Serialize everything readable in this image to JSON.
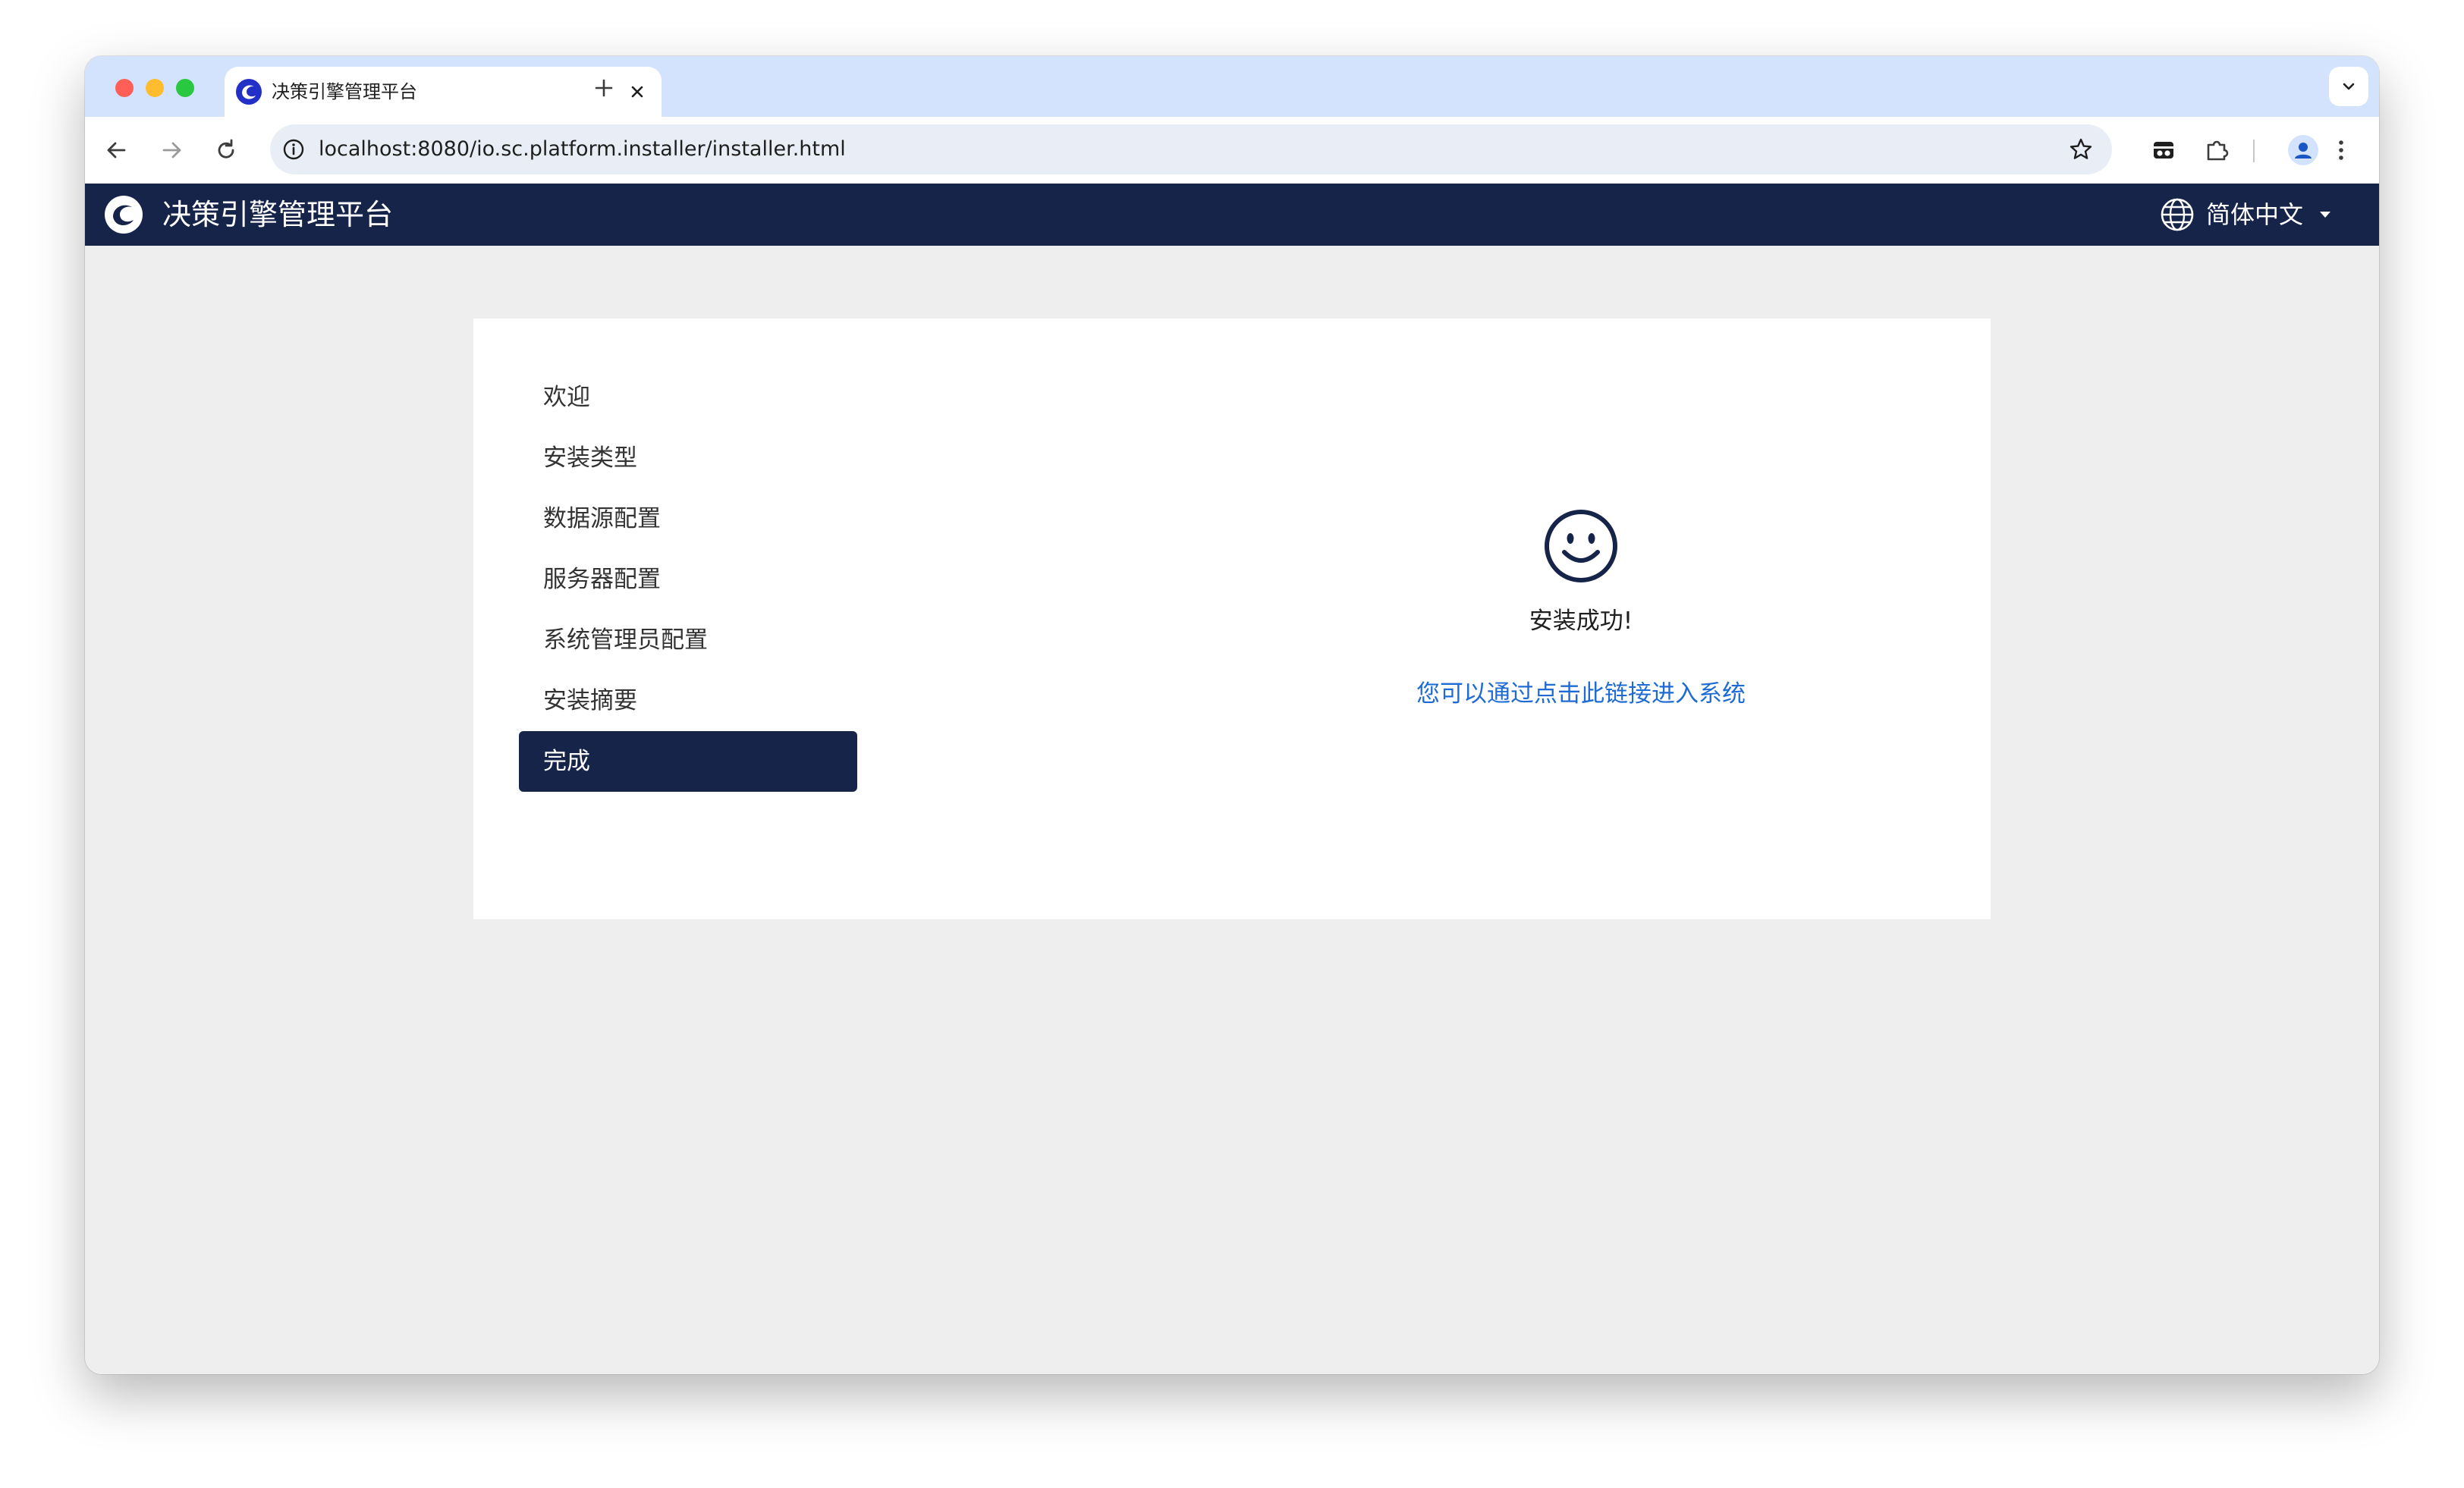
{
  "browser": {
    "tab": {
      "title": "决策引擎管理平台",
      "favicon": "app-logo-icon"
    },
    "url": "localhost:8080/io.sc.platform.installer/installer.html"
  },
  "app": {
    "title": "决策引擎管理平台",
    "language": "简体中文"
  },
  "steps": [
    {
      "label": "欢迎",
      "active": false
    },
    {
      "label": "安装类型",
      "active": false
    },
    {
      "label": "数据源配置",
      "active": false
    },
    {
      "label": "服务器配置",
      "active": false
    },
    {
      "label": "系统管理员配置",
      "active": false
    },
    {
      "label": "安装摘要",
      "active": false
    },
    {
      "label": "完成",
      "active": true
    }
  ],
  "result": {
    "icon": "smiley-icon",
    "message": "安装成功!",
    "link": "您可以通过点击此链接进入系统"
  },
  "colors": {
    "header_bg": "#17244a",
    "active_step_bg": "#17244a",
    "link": "#1f6bd4",
    "tabstrip_bg": "#d3e3fd",
    "page_bg": "#eeeeee"
  }
}
